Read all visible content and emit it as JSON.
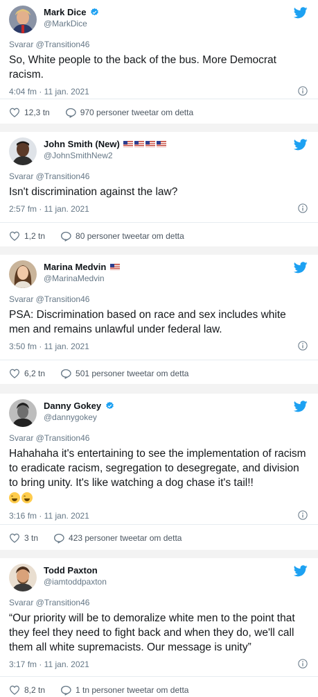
{
  "tweets": [
    {
      "name": "Mark Dice",
      "handle": "@MarkDice",
      "verified": true,
      "flags": 0,
      "reply_to": "Svarar @Transition46",
      "text": "So, White people to the back of the bus.   More Democrat racism.",
      "time": "4:04 fm · 11 jan. 2021",
      "likes": "12,3 tn",
      "retweets": "970 personer tweetar om detta"
    },
    {
      "name": "John Smith (New)",
      "handle": "@JohnSmithNew2",
      "verified": false,
      "flags": 4,
      "reply_to": "Svarar @Transition46",
      "text": "Isn't discrimination against the law?",
      "time": "2:57 fm · 11 jan. 2021",
      "likes": "1,2 tn",
      "retweets": "80 personer tweetar om detta"
    },
    {
      "name": "Marina Medvin",
      "handle": "@MarinaMedvin",
      "verified": false,
      "flags": 1,
      "reply_to": "Svarar @Transition46",
      "text": "PSA: Discrimination based on race and sex includes white men and remains unlawful under federal law.",
      "time": "3:50 fm · 11 jan. 2021",
      "likes": "6,2 tn",
      "retweets": "501 personer tweetar om detta"
    },
    {
      "name": "Danny Gokey",
      "handle": "@dannygokey",
      "verified": true,
      "flags": 0,
      "reply_to": "Svarar @Transition46",
      "text": "Hahahaha it's entertaining to see the implementation of racism to eradicate racism, segregation to desegregate, and division to bring unity. It's like watching a dog chase it's tail!!",
      "time": "3:16 fm · 11 jan. 2021",
      "likes": "3 tn",
      "retweets": "423 personer tweetar om detta"
    },
    {
      "name": "Todd Paxton",
      "handle": "@iamtoddpaxton",
      "verified": false,
      "flags": 0,
      "reply_to": "Svarar @Transition46",
      "text": "“Our priority will be to demoralize white men to the point that they feel they need to fight back and when they do, we'll call them all white supremacists. Our message is unity”",
      "time": "3:17 fm · 11 jan. 2021",
      "likes": "8,2 tn",
      "retweets": "1 tn personer tweetar om detta"
    }
  ],
  "colors": {
    "twitter_blue": "#1da1f2",
    "verified_blue": "#1da1f2",
    "secondary_text": "#657786"
  },
  "icons": {
    "bird": "twitter-bird-icon",
    "verified": "verified-badge-icon",
    "info": "info-icon",
    "like": "heart-icon",
    "retweet": "speech-bubble-icon",
    "emoji": "face-with-tears-of-joy-icon"
  }
}
